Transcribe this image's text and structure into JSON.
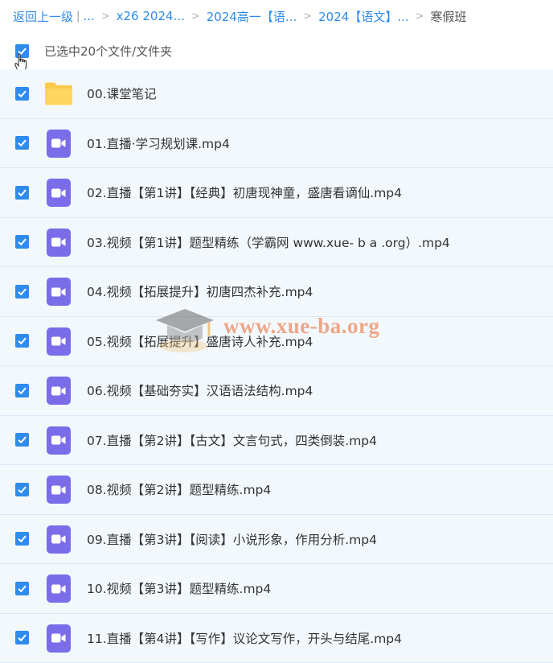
{
  "breadcrumb": {
    "back": "返回上一级",
    "items": [
      "...",
      "x26 2024...",
      "2024高一【语...",
      "2024【语文】..."
    ],
    "current": "寒假班"
  },
  "selection": {
    "text": "已选中20个文件/文件夹"
  },
  "files": [
    {
      "name": "00.课堂笔记",
      "type": "folder"
    },
    {
      "name": "01.直播·学习规划课.mp4",
      "type": "video"
    },
    {
      "name": "02.直播【第1讲】【经典】初唐现神童，盛唐看谪仙.mp4",
      "type": "video"
    },
    {
      "name": "03.视频【第1讲】题型精练（学霸网 www.xue- b a .org）.mp4",
      "type": "video"
    },
    {
      "name": "04.视频【拓展提升】初唐四杰补充.mp4",
      "type": "video"
    },
    {
      "name": "05.视频【拓展提升】盛唐诗人补充.mp4",
      "type": "video"
    },
    {
      "name": "06.视频【基础夯实】汉语语法结构.mp4",
      "type": "video"
    },
    {
      "name": "07.直播【第2讲】【古文】文言句式，四类倒装.mp4",
      "type": "video"
    },
    {
      "name": "08.视频【第2讲】题型精练.mp4",
      "type": "video"
    },
    {
      "name": "09.直播【第3讲】【阅读】小说形象，作用分析.mp4",
      "type": "video"
    },
    {
      "name": "10.视频【第3讲】题型精练.mp4",
      "type": "video"
    },
    {
      "name": "11.直播【第4讲】【写作】议论文写作，开头与结尾.mp4",
      "type": "video"
    }
  ],
  "watermark": {
    "text": "www.xue-ba.org"
  },
  "colors": {
    "accent": "#2f8ceb",
    "video_icon": "#7b6ce9",
    "folder": "#fcc94a",
    "row_bg": "#f3f8fd"
  }
}
